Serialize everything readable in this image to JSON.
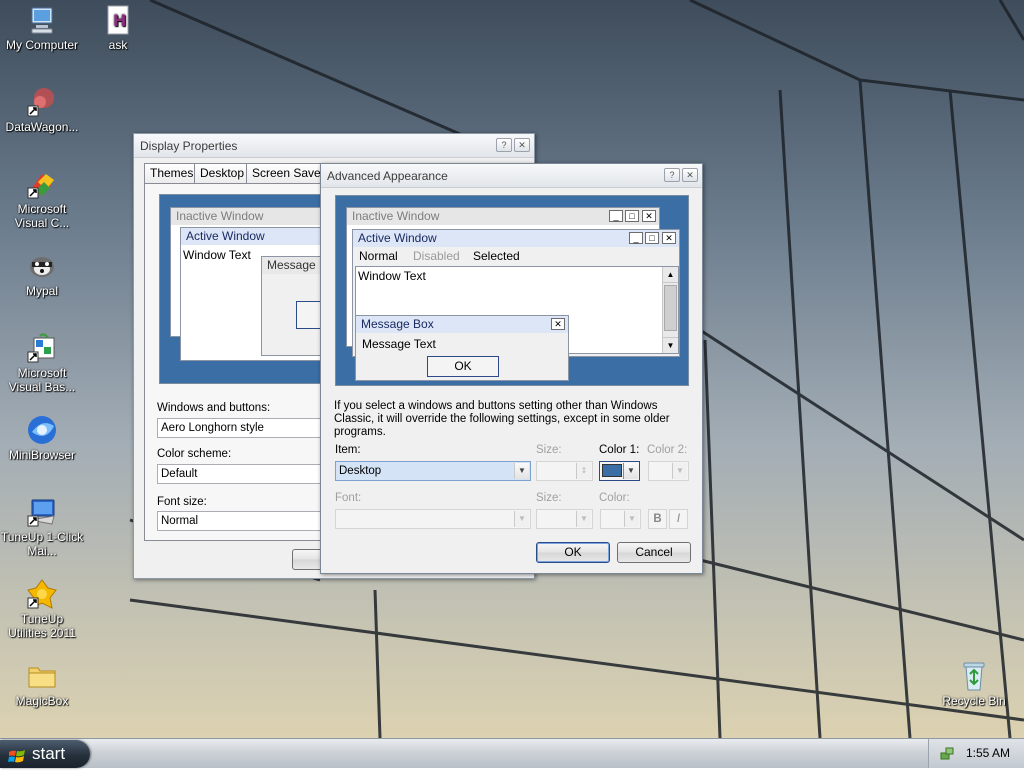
{
  "desktop": {
    "icons": [
      {
        "label": "My Computer",
        "icon": "computer-icon"
      },
      {
        "label": "ask",
        "icon": "document-icon"
      },
      {
        "label": "DataWagon...",
        "icon": "datawagon-icon"
      },
      {
        "label": "Microsoft Visual C...",
        "icon": "visual-c-icon"
      },
      {
        "label": "Mypal",
        "icon": "mypal-icon"
      },
      {
        "label": "Microsoft Visual Bas...",
        "icon": "visual-basic-icon"
      },
      {
        "label": "MiniBrowser",
        "icon": "minibrowser-icon"
      },
      {
        "label": "TuneUp 1-Click Mai...",
        "icon": "tuneup-icon"
      },
      {
        "label": "TuneUp Utilities 2011",
        "icon": "tuneup-utilities-icon"
      },
      {
        "label": "MagicBox",
        "icon": "folder-icon"
      },
      {
        "label": "Recycle Bin",
        "icon": "recycle-bin-icon"
      }
    ]
  },
  "display_properties": {
    "title": "Display Properties",
    "tabs": [
      "Themes",
      "Desktop",
      "Screen Saver"
    ],
    "preview": {
      "inactive_title": "Inactive Window",
      "active_title": "Active Window",
      "window_text": "Window Text",
      "message_title": "Message B"
    },
    "windows_buttons_label": "Windows and buttons:",
    "windows_buttons_value": "Aero Longhorn style",
    "color_scheme_label": "Color scheme:",
    "color_scheme_value": "Default",
    "font_size_label": "Font size:",
    "font_size_value": "Normal"
  },
  "advanced_appearance": {
    "title": "Advanced Appearance",
    "preview": {
      "inactive_title": "Inactive Window",
      "active_title": "Active Window",
      "menu_normal": "Normal",
      "menu_disabled": "Disabled",
      "menu_selected": "Selected",
      "window_text": "Window Text",
      "message_box_title": "Message Box",
      "message_text": "Message Text",
      "ok": "OK"
    },
    "info_text": "If you select a windows and buttons setting other than Windows Classic, it will override the following settings, except in some older programs.",
    "item_label": "Item:",
    "item_value": "Desktop",
    "size_label": "Size:",
    "color1_label": "Color 1:",
    "color2_label": "Color 2:",
    "font_label": "Font:",
    "font_size_label": "Size:",
    "font_color_label": "Color:",
    "bold_label": "B",
    "italic_label": "I",
    "ok_label": "OK",
    "cancel_label": "Cancel",
    "color1_value": "#3a6ea5",
    "preview_background": "#3a6ea5"
  },
  "taskbar": {
    "start_label": "start",
    "clock": "1:55 AM"
  }
}
